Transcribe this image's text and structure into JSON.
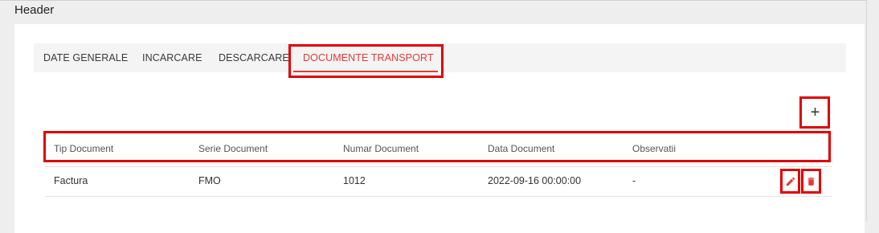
{
  "header": {
    "title": "Header"
  },
  "tabs": [
    {
      "label": "DATE GENERALE"
    },
    {
      "label": "INCARCARE"
    },
    {
      "label": "DESCARCARE"
    },
    {
      "label": "DOCUMENTE TRANSPORT"
    }
  ],
  "active_tab": "DOCUMENTE TRANSPORT",
  "toolbar": {
    "add_label": "+"
  },
  "table": {
    "columns": [
      "Tip Document",
      "Serie Document",
      "Numar Document",
      "Data Document",
      "Observatii"
    ],
    "rows": [
      {
        "cells": [
          "Factura",
          "FMO",
          "1012",
          "2022-09-16 00:00:00",
          "-"
        ]
      }
    ]
  },
  "colors": {
    "accent": "#e53935",
    "highlight": "#e00000"
  },
  "icons": {
    "edit": "pencil-icon",
    "delete": "trash-icon"
  }
}
